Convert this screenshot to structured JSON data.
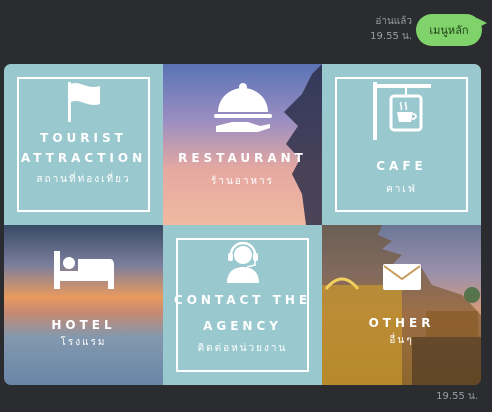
{
  "chat": {
    "read_status": "อ่านแล้ว",
    "sent_time": "19.55 น.",
    "user_message": "เมนูหลัก",
    "bottom_time": "19.55 น."
  },
  "menu": {
    "tiles": [
      {
        "en": "TOURIST ATTRACTION",
        "th": "สถานที่ท่องเที่ยว",
        "icon": "flag-icon"
      },
      {
        "en": "RESTAURANT",
        "th": "ร้านอาหาร",
        "icon": "cloche-icon"
      },
      {
        "en": "CAFE",
        "th": "คาเฟ่",
        "icon": "coffee-sign-icon"
      },
      {
        "en": "HOTEL",
        "th": "โรงแรม",
        "icon": "bed-icon"
      },
      {
        "en": "CONTACT THE AGENCY",
        "th": "ติดต่อหน่วยงาน",
        "icon": "headset-agent-icon"
      },
      {
        "en": "OTHER",
        "th": "อื่นๆ",
        "icon": "envelope-icon"
      }
    ]
  },
  "colors": {
    "background": "#2b2c2f",
    "bubble": "#7fd36a",
    "teal": "#9ac8cf"
  }
}
